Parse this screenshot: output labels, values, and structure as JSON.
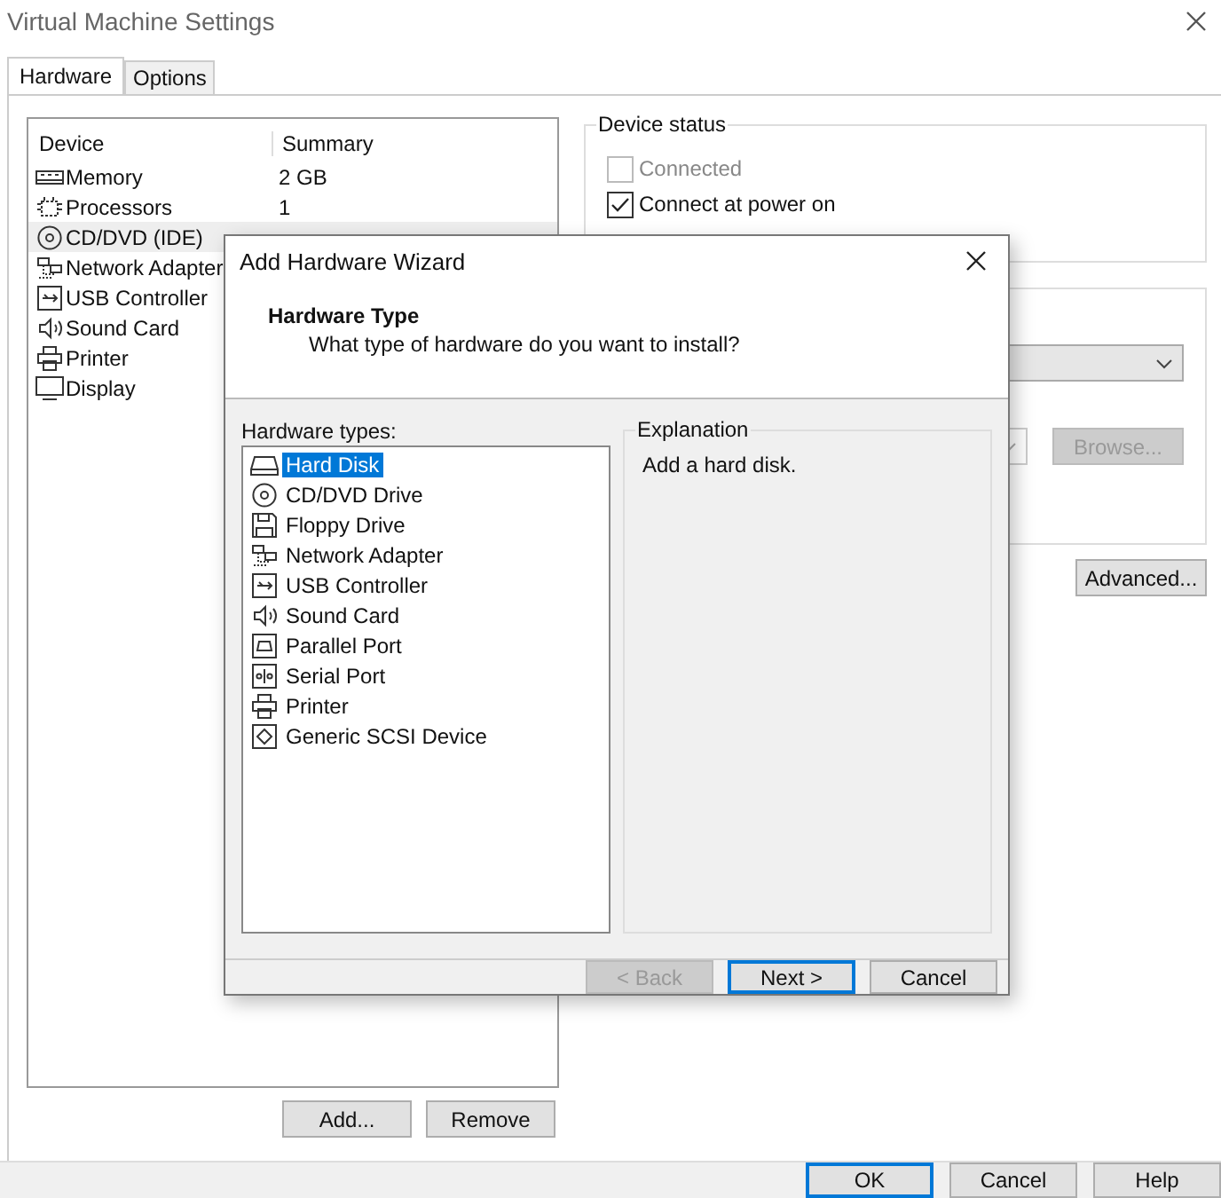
{
  "window": {
    "title": "Virtual Machine Settings"
  },
  "tabs": [
    {
      "label": "Hardware",
      "selected": true
    },
    {
      "label": "Options",
      "selected": false
    }
  ],
  "device_table": {
    "columns": [
      "Device",
      "Summary"
    ],
    "rows": [
      {
        "name": "Memory",
        "summary": "2 GB",
        "kind": "memory",
        "selected": false
      },
      {
        "name": "Processors",
        "summary": "1",
        "kind": "processor",
        "selected": false
      },
      {
        "name": "CD/DVD (IDE)",
        "kind": "cdrom",
        "selected": true
      },
      {
        "name": "Network Adapter",
        "kind": "network",
        "selected": false
      },
      {
        "name": "USB Controller",
        "kind": "usb",
        "selected": false
      },
      {
        "name": "Sound Card",
        "kind": "sound",
        "selected": false
      },
      {
        "name": "Printer",
        "kind": "printer",
        "selected": false
      },
      {
        "name": "Display",
        "kind": "display",
        "selected": false
      }
    ]
  },
  "device_status": {
    "title": "Device status",
    "options": [
      {
        "label": "Connected",
        "checked": false,
        "disabled": true
      },
      {
        "label": "Connect at power on",
        "checked": true,
        "disabled": false
      }
    ]
  },
  "connection": {
    "browse_button": {
      "label": "Browse...",
      "disabled": true
    },
    "advanced_button": {
      "label": "Advanced...",
      "disabled": false
    }
  },
  "list_buttons": [
    {
      "label": "Add..."
    },
    {
      "label": "Remove"
    }
  ],
  "footer_buttons": [
    {
      "label": "OK",
      "default": true
    },
    {
      "label": "Cancel",
      "default": false
    },
    {
      "label": "Help",
      "default": false
    }
  ],
  "dialog": {
    "title": "Add Hardware Wizard",
    "heading": "Hardware Type",
    "subtitle": "What type of hardware do you want to install?",
    "list_label": "Hardware types:",
    "types": [
      {
        "label": "Hard Disk",
        "kind": "harddisk",
        "selected": true
      },
      {
        "label": "CD/DVD Drive",
        "kind": "cdrom",
        "selected": false
      },
      {
        "label": "Floppy Drive",
        "kind": "floppy",
        "selected": false
      },
      {
        "label": "Network Adapter",
        "kind": "network",
        "selected": false
      },
      {
        "label": "USB Controller",
        "kind": "usb",
        "selected": false
      },
      {
        "label": "Sound Card",
        "kind": "sound",
        "selected": false
      },
      {
        "label": "Parallel Port",
        "kind": "parallel",
        "selected": false
      },
      {
        "label": "Serial Port",
        "kind": "serial",
        "selected": false
      },
      {
        "label": "Printer",
        "kind": "printer",
        "selected": false
      },
      {
        "label": "Generic SCSI Device",
        "kind": "scsi",
        "selected": false
      }
    ],
    "explanation": {
      "title": "Explanation",
      "text": "Add a hard disk."
    },
    "buttons": [
      {
        "label": "< Back",
        "disabled": true,
        "default": false
      },
      {
        "label": "Next >",
        "disabled": false,
        "default": true
      },
      {
        "label": "Cancel",
        "disabled": false,
        "default": false
      }
    ]
  }
}
